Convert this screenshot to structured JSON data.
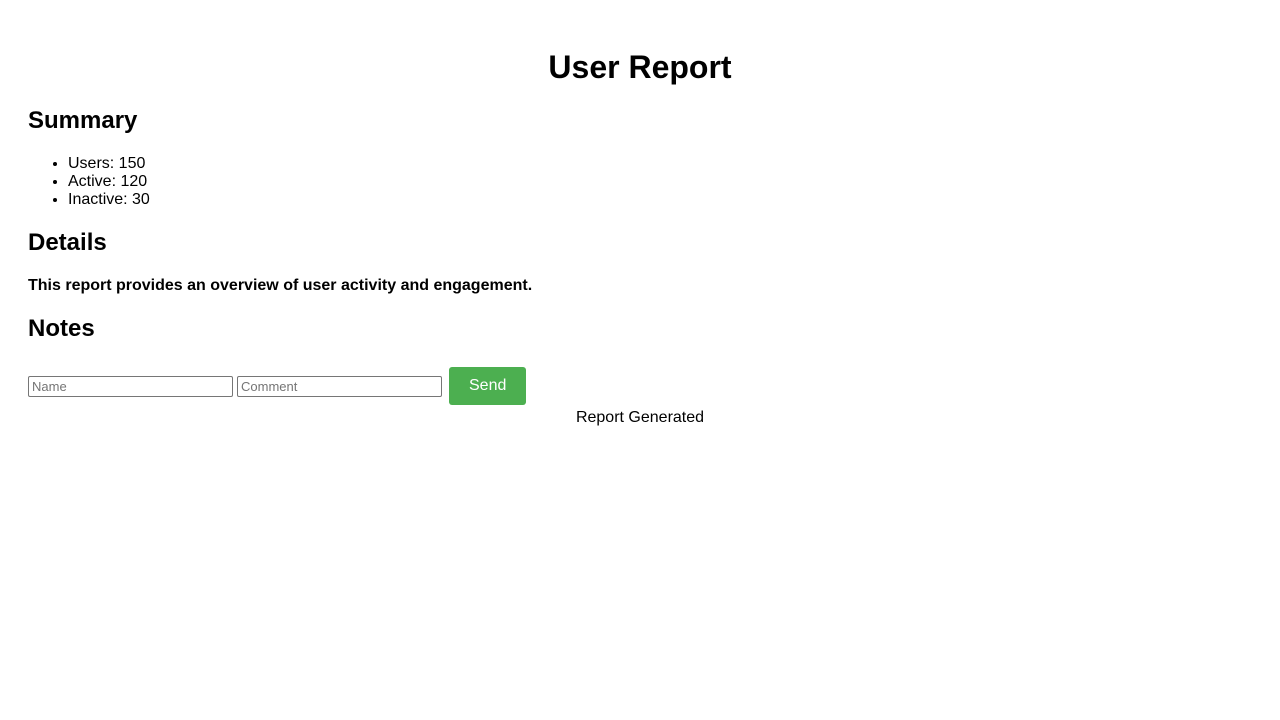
{
  "title": "User Report",
  "summary": {
    "heading": "Summary",
    "items": [
      "Users: 150",
      "Active: 120",
      "Inactive: 30"
    ]
  },
  "details": {
    "heading": "Details",
    "text": "This report provides an overview of user activity and engagement."
  },
  "notes": {
    "heading": "Notes",
    "name_placeholder": "Name",
    "name_value": "",
    "comment_placeholder": "Comment",
    "comment_value": "",
    "send_label": "Send",
    "send_color": "#4caf50"
  },
  "footer": "Report Generated"
}
